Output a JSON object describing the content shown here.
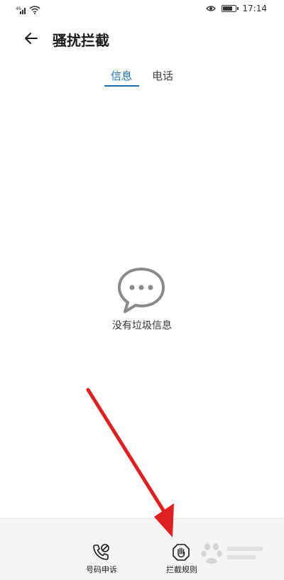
{
  "status_bar": {
    "time": "17:14",
    "signal_text": "46",
    "battery_level": 0.8,
    "icons": [
      "signal-icon",
      "wifi-icon",
      "eye-icon",
      "battery-icon"
    ]
  },
  "header": {
    "title": "骚扰拦截",
    "back_icon": "arrow-left-icon"
  },
  "tabs": [
    {
      "label": "信息",
      "active": true
    },
    {
      "label": "电话",
      "active": false
    }
  ],
  "empty_state": {
    "icon": "chat-bubble-icon",
    "text": "没有垃圾信息"
  },
  "bottom_bar": {
    "appeal_label": "号码申诉",
    "rules_label": "拦截规则"
  },
  "colors": {
    "accent": "#1a6fb3",
    "arrow": "#e02020",
    "icon_gray": "#8a8a8a"
  }
}
